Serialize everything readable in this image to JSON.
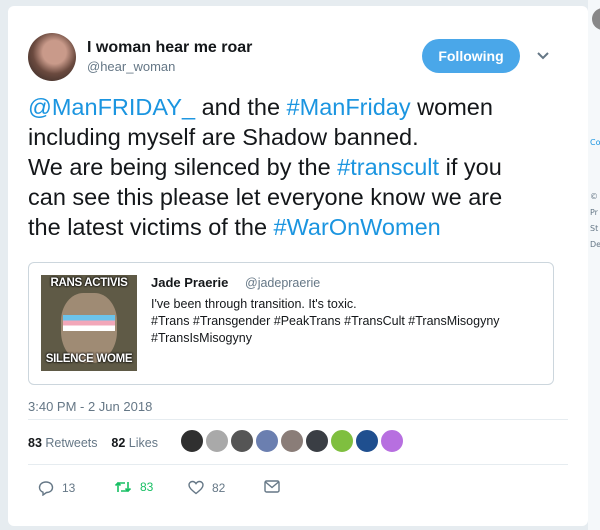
{
  "tweet": {
    "display_name": "I woman hear me roar",
    "handle": "@hear_woman",
    "follow_label": "Following",
    "text_lines": [
      [
        {
          "t": "@ManFRIDAY_",
          "link": true
        },
        {
          "t": " and the ",
          "link": false
        },
        {
          "t": "#ManFriday",
          "link": true
        },
        {
          "t": " women",
          "link": false
        }
      ],
      [
        {
          "t": "including myself are Shadow banned.",
          "link": false
        }
      ],
      [
        {
          "t": "We are being silenced by the ",
          "link": false
        },
        {
          "t": "#transcult",
          "link": true
        },
        {
          "t": " if you",
          "link": false
        }
      ],
      [
        {
          "t": "can see this please let everyone know we are",
          "link": false
        }
      ],
      [
        {
          "t": "the latest victims of the ",
          "link": false
        },
        {
          "t": "#WarOnWomen",
          "link": true
        }
      ]
    ],
    "timestamp": "3:40 PM - 2 Jun 2018"
  },
  "quote": {
    "name": "Jade Praerie",
    "handle": "@jadepraerie",
    "image_top_text": "RANS ACTIVIS",
    "image_bottom_text": "SILENCE WOME",
    "lines": [
      "I've been through transition. It's toxic.",
      "#Trans #Transgender #PeakTrans #TransCult #TransMisogyny",
      "#TransIsMisogyny"
    ]
  },
  "stats": {
    "retweets_count": "83",
    "retweets_label": "Retweets",
    "likes_count": "82",
    "likes_label": "Likes"
  },
  "likers": [
    {
      "icon": "avatar",
      "color": "#2f2f2f"
    },
    {
      "icon": "avatar",
      "color": "#a9a9a9"
    },
    {
      "icon": "avatar",
      "color": "#555555"
    },
    {
      "icon": "avatar",
      "color": "#6b7fb0"
    },
    {
      "icon": "avatar",
      "color": "#8a7d78"
    },
    {
      "icon": "avatar",
      "color": "#3a3e44"
    },
    {
      "icon": "avatar",
      "color": "#7fbf3f"
    },
    {
      "icon": "avatar",
      "color": "#1f4f8f"
    },
    {
      "icon": "avatar",
      "color": "#b76fe0"
    }
  ],
  "actions": {
    "reply_count": "13",
    "retweet_count": "83",
    "like_count": "82"
  },
  "colors": {
    "accent": "#1b95e0",
    "follow_bg": "#4aa7e9",
    "retweet_green": "#17bf63"
  },
  "sidebar_strip": {
    "texts": [
      "Co",
      "©",
      "Pr",
      "St",
      "De"
    ]
  }
}
